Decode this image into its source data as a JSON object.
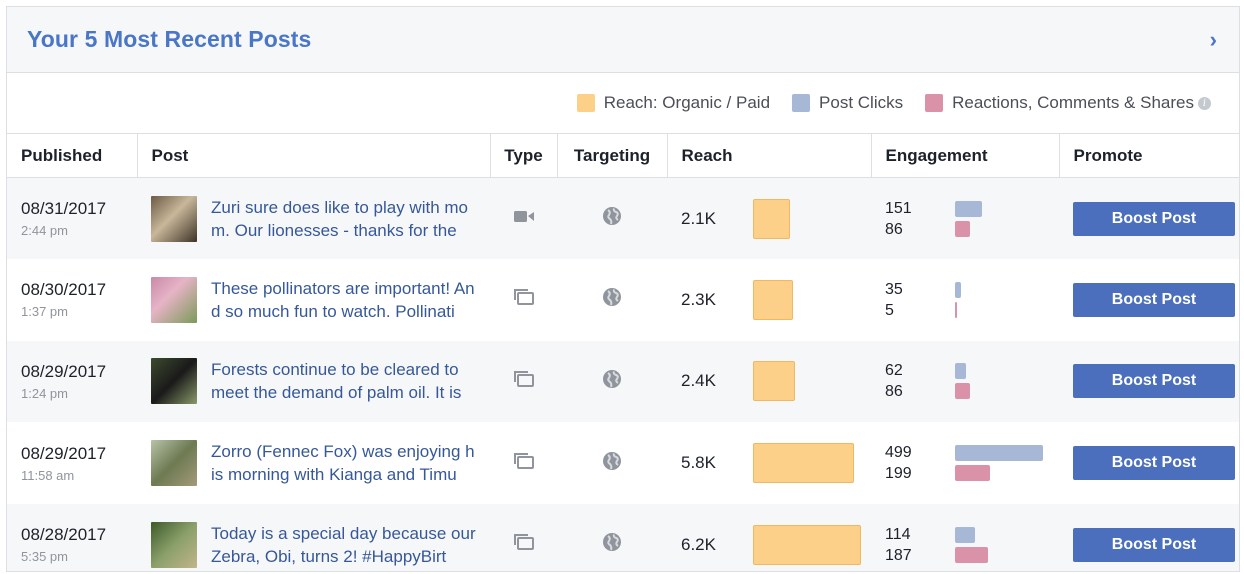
{
  "header": {
    "title": "Your 5 Most Recent Posts",
    "chevron_icon": "chevron-right-icon"
  },
  "legend": {
    "reach_label": "Reach: Organic / Paid",
    "clicks_label": "Post Clicks",
    "reactions_label": "Reactions, Comments & Shares",
    "info_icon": "info-icon",
    "colors": {
      "reach": "#fcd088",
      "clicks": "#a7b7d6",
      "reactions": "#d992a8"
    }
  },
  "columns": {
    "published": "Published",
    "post": "Post",
    "type": "Type",
    "targeting": "Targeting",
    "reach": "Reach",
    "engagement": "Engagement",
    "promote": "Promote"
  },
  "rows": [
    {
      "date": "08/31/2017",
      "time": "2:44 pm",
      "text": "Zuri sure does like to play with mom. Our lionesses - thanks for the",
      "type_icon": "video-icon",
      "targeting_icon": "globe-icon",
      "reach": "2.1K",
      "reach_value": 2100,
      "clicks": "151",
      "reactions": "86",
      "clicks_value": 151,
      "reactions_value": 86,
      "boost": "Boost Post"
    },
    {
      "date": "08/30/2017",
      "time": "1:37 pm",
      "text": "These pollinators are important! And so much fun to watch. Pollinati",
      "type_icon": "photo-album-icon",
      "targeting_icon": "globe-icon",
      "reach": "2.3K",
      "reach_value": 2300,
      "clicks": "35",
      "reactions": "5",
      "clicks_value": 35,
      "reactions_value": 5,
      "boost": "Boost Post"
    },
    {
      "date": "08/29/2017",
      "time": "1:24 pm",
      "text": "Forests continue to be cleared to meet the demand of palm oil. It is",
      "type_icon": "photo-album-icon",
      "targeting_icon": "globe-icon",
      "reach": "2.4K",
      "reach_value": 2400,
      "clicks": "62",
      "reactions": "86",
      "clicks_value": 62,
      "reactions_value": 86,
      "boost": "Boost Post"
    },
    {
      "date": "08/29/2017",
      "time": "11:58 am",
      "text": "Zorro (Fennec Fox) was enjoying his morning with Kianga and Timu",
      "type_icon": "photo-album-icon",
      "targeting_icon": "globe-icon",
      "reach": "5.8K",
      "reach_value": 5800,
      "clicks": "499",
      "reactions": "199",
      "clicks_value": 499,
      "reactions_value": 199,
      "boost": "Boost Post"
    },
    {
      "date": "08/28/2017",
      "time": "5:35 pm",
      "text": "Today is a special day because our Zebra, Obi, turns 2! #HappyBirt",
      "type_icon": "photo-album-icon",
      "targeting_icon": "globe-icon",
      "reach": "6.2K",
      "reach_value": 6200,
      "clicks": "114",
      "reactions": "187",
      "clicks_value": 114,
      "reactions_value": 187,
      "boost": "Boost Post"
    }
  ]
}
